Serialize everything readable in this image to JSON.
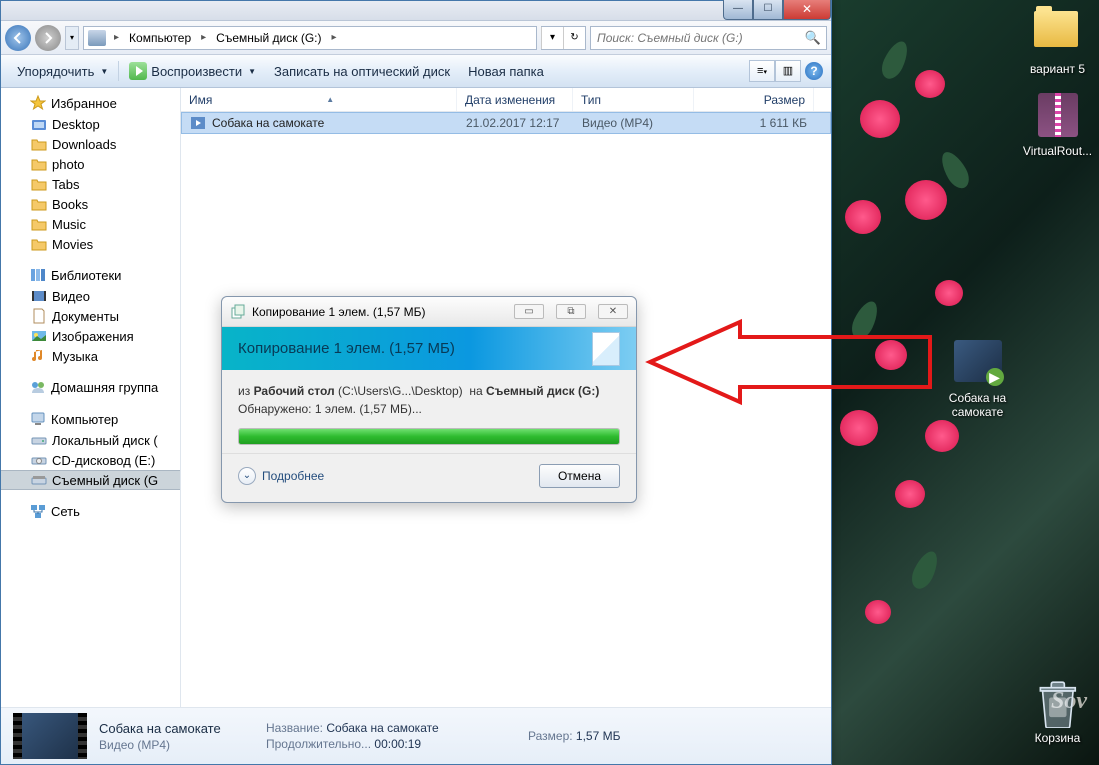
{
  "titlebar": {
    "min_glyph": "—",
    "max_glyph": "☐",
    "close_glyph": "✕"
  },
  "nav": {
    "breadcrumb": {
      "computer_icon": "computer-icon",
      "segments": [
        "Компьютер",
        "Съемный диск (G:)"
      ],
      "arrow": "▸",
      "down": "▾",
      "refresh": "↻"
    },
    "search_placeholder": "Поиск: Съемный диск (G:)"
  },
  "toolbar": {
    "organize": "Упорядочить",
    "play": "Воспроизвести",
    "burn": "Записать на оптический диск",
    "new_folder": "Новая папка",
    "help_glyph": "?"
  },
  "sidebar": {
    "favorites": {
      "label": "Избранное",
      "items": [
        "Desktop",
        "Downloads",
        "photo",
        "Tabs",
        "Books",
        "Music",
        "Movies"
      ]
    },
    "libraries": {
      "label": "Библиотеки",
      "items": [
        "Видео",
        "Документы",
        "Изображения",
        "Музыка"
      ]
    },
    "homegroup": "Домашняя группа",
    "computer": {
      "label": "Компьютер",
      "items": [
        {
          "label": "Локальный диск (",
          "selected": false
        },
        {
          "label": "CD-дисковод (E:)",
          "selected": false
        },
        {
          "label": "Съемный диск (G",
          "selected": true
        }
      ]
    },
    "network": "Сеть"
  },
  "columns": {
    "name": "Имя",
    "date": "Дата изменения",
    "type": "Тип",
    "size": "Размер"
  },
  "files": [
    {
      "name": "Собака на самокате",
      "date": "21.02.2017 12:17",
      "type": "Видео (MP4)",
      "size": "1 611 КБ",
      "selected": true
    }
  ],
  "details": {
    "title": "Собака на самокате",
    "subtitle": "Видео (MP4)",
    "name_label": "Название:",
    "name_value": "Собака на самокате",
    "duration_label": "Продолжительно...",
    "duration_value": "00:00:19",
    "size_label": "Размер:",
    "size_value": "1,57 МБ"
  },
  "dialog": {
    "window_title": "Копирование 1 элем. (1,57 МБ)",
    "header": "Копирование 1 элем. (1,57 МБ)",
    "from_label": "из",
    "from_bold": "Рабочий стол",
    "from_path": "(C:\\Users\\G...\\Desktop)",
    "to_label": "на",
    "to_bold": "Съемный диск (G:)",
    "discovered": "Обнаружено: 1 элем. (1,57 МБ)...",
    "more": "Подробнее",
    "cancel": "Отмена",
    "min": "▭",
    "max": "⧉",
    "close": "✕"
  },
  "desktop_icons": {
    "variant5": "вариант 5",
    "virtualrouter": "VirtualRout...",
    "router_icon": "app-icon",
    "dog_video": "Собака на самокате",
    "recycle": "Корзина"
  }
}
